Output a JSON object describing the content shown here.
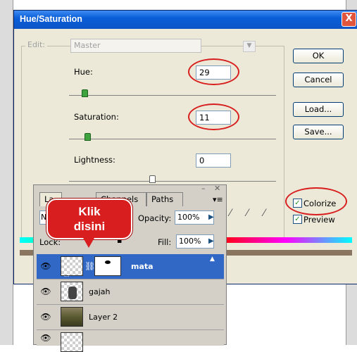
{
  "dialog": {
    "title": "Hue/Saturation",
    "close_glyph": "X",
    "edit_label": "Edit:",
    "edit_value": "Master",
    "hue_label": "Hue:",
    "hue_value": "29",
    "saturation_label": "Saturation:",
    "saturation_value": "11",
    "lightness_label": "Lightness:",
    "lightness_value": "0",
    "buttons": {
      "ok": "OK",
      "cancel": "Cancel",
      "load": "Load...",
      "save": "Save..."
    },
    "colorize_label": "Colorize",
    "preview_label": "Preview"
  },
  "layers": {
    "tabs": [
      "La",
      "Channels",
      "Paths"
    ],
    "blend_mode": "No",
    "opacity_label": "Opacity:",
    "opacity_value": "100%",
    "lock_label": "Lock:",
    "fill_label": "Fill:",
    "fill_value": "100%",
    "rows": [
      {
        "name": "mata",
        "selected": true
      },
      {
        "name": "gajah",
        "selected": false
      },
      {
        "name": "Layer 2",
        "selected": false
      }
    ]
  },
  "callout": {
    "line1": "Klik",
    "line2": "disini"
  },
  "colors": {
    "title_bar": "#0a5ed8",
    "highlight_ring": "#d81e1e",
    "selection": "#3168c6",
    "thumb": "#3fa33f"
  }
}
